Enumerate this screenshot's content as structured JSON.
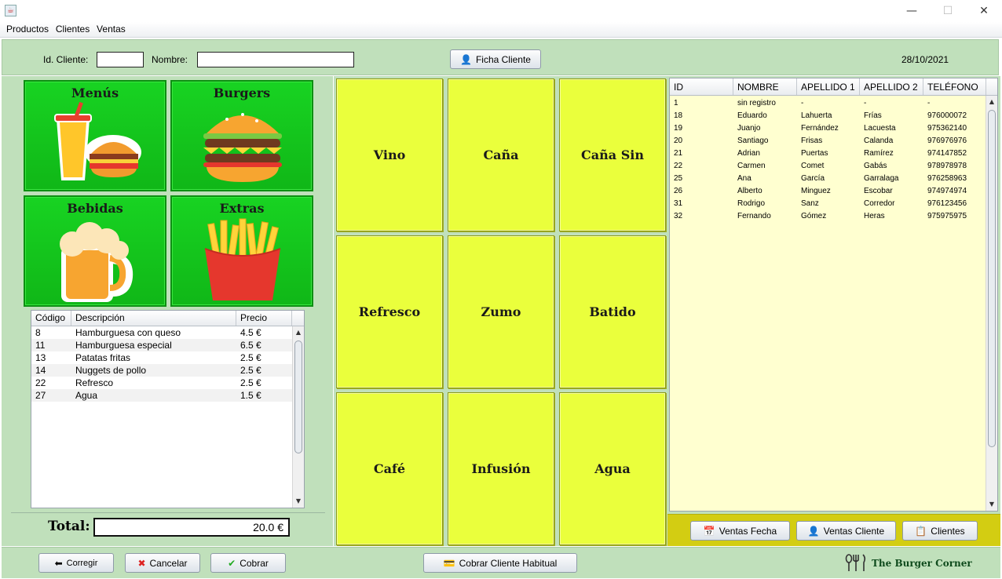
{
  "window": {
    "minimize": "—",
    "maximize": "☐",
    "close": "✕"
  },
  "menu": [
    "Productos",
    "Clientes",
    "Ventas"
  ],
  "header": {
    "id_label": "Id. Cliente:",
    "id_value": "",
    "name_label": "Nombre:",
    "name_value": "",
    "ficha_button": "Ficha Cliente",
    "date": "28/10/2021"
  },
  "categories": [
    "Menús",
    "Burgers",
    "Bebidas",
    "Extras"
  ],
  "order_table": {
    "columns": [
      "Código",
      "Descripción",
      "Precio"
    ],
    "rows": [
      [
        "8",
        "Hamburguesa con queso",
        "4.5 €"
      ],
      [
        "11",
        "Hamburguesa especial",
        "6.5 €"
      ],
      [
        "13",
        "Patatas fritas",
        "2.5 €"
      ],
      [
        "14",
        "Nuggets de pollo",
        "2.5 €"
      ],
      [
        "22",
        "Refresco",
        "2.5 €"
      ],
      [
        "27",
        "Agua",
        "1.5 €"
      ]
    ]
  },
  "total": {
    "label": "Total:",
    "value": "20.0 €"
  },
  "products": [
    "Vino",
    "Caña",
    "Caña Sin",
    "Refresco",
    "Zumo",
    "Batido",
    "Café",
    "Infusión",
    "Agua"
  ],
  "clients_table": {
    "columns": [
      "ID",
      "NOMBRE",
      "APELLIDO 1",
      "APELLIDO 2",
      "TELÉFONO"
    ],
    "rows": [
      [
        "1",
        "sin registro",
        "-",
        "-",
        "-"
      ],
      [
        "18",
        "Eduardo",
        "Lahuerta",
        "Frías",
        "976000072"
      ],
      [
        "19",
        "Juanjo",
        "Fernández",
        "Lacuesta",
        "975362140"
      ],
      [
        "20",
        "Santiago",
        "Frisas",
        "Calanda",
        "976976976"
      ],
      [
        "21",
        "Adrian",
        "Puertas",
        "Ramírez",
        "974147852"
      ],
      [
        "22",
        "Carmen",
        "Comet",
        "Gabás",
        "978978978"
      ],
      [
        "25",
        "Ana",
        "García",
        "Garralaga",
        "976258963"
      ],
      [
        "26",
        "Alberto",
        "Minguez",
        "Escobar",
        "974974974"
      ],
      [
        "31",
        "Rodrigo",
        "Sanz",
        "Corredor",
        "976123456"
      ],
      [
        "32",
        "Fernando",
        "Gómez",
        "Heras",
        "975975975"
      ]
    ]
  },
  "client_buttons": {
    "ventas_fecha": "Ventas Fecha",
    "ventas_cliente": "Ventas Cliente",
    "clientes": "Clientes"
  },
  "footer": {
    "corregir": "Corregir",
    "cancelar": "Cancelar",
    "cobrar": "Cobrar",
    "cobrar_habitual": "Cobrar Cliente Habitual",
    "brand": "The Burger Corner"
  },
  "colors": {
    "panel_green": "#c0e0bb",
    "category_green": "#14c81c",
    "product_yellow": "#eaff3c",
    "client_table_bg": "#ffffd0",
    "client_buttons_bar": "#d3cd12"
  }
}
